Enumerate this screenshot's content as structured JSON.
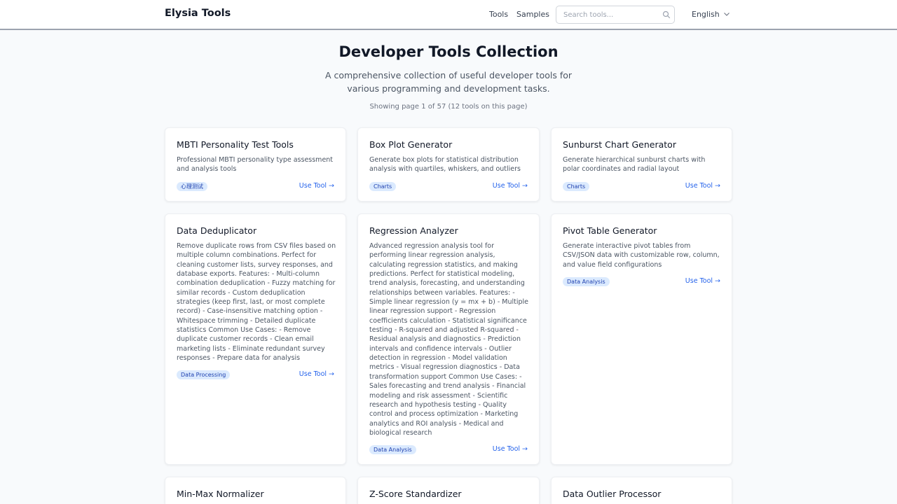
{
  "header": {
    "logo": "Elysia Tools",
    "nav": {
      "tools": "Tools",
      "samples": "Samples"
    },
    "search_placeholder": "Search tools...",
    "search_icon": "search-icon",
    "language": "English"
  },
  "hero": {
    "title": "Developer Tools Collection",
    "subtitle": "A comprehensive collection of useful developer tools for various programming and development tasks.",
    "page_info": "Showing page 1 of 57 (12 tools on this page)"
  },
  "cards": [
    {
      "title": "MBTI Personality Test Tools",
      "description": "Professional MBTI personality type assessment and analysis tools",
      "tag": "心理测试",
      "link": "Use Tool →"
    },
    {
      "title": "Box Plot Generator",
      "description": "Generate box plots for statistical distribution analysis with quartiles, whiskers, and outliers",
      "tag": "Charts",
      "link": "Use Tool →"
    },
    {
      "title": "Sunburst Chart Generator",
      "description": "Generate hierarchical sunburst charts with polar coordinates and radial layout",
      "tag": "Charts",
      "link": "Use Tool →"
    },
    {
      "title": "Data Deduplicator",
      "description": "Remove duplicate rows from CSV files based on multiple column combinations. Perfect for cleaning customer lists, survey responses, and database exports. Features: - Multi-column combination deduplication - Fuzzy matching for similar records - Custom deduplication strategies (keep first, last, or most complete record) - Case-insensitive matching option - Whitespace trimming - Detailed duplicate statistics Common Use Cases: - Remove duplicate customer records - Clean email marketing lists - Eliminate redundant survey responses - Prepare data for analysis",
      "tag": "Data Processing",
      "link": "Use Tool →"
    },
    {
      "title": "Regression Analyzer",
      "description": "Advanced regression analysis tool for performing linear regression analysis, calculating regression statistics, and making predictions. Perfect for statistical modeling, trend analysis, forecasting, and understanding relationships between variables. Features: - Simple linear regression (y = mx + b) - Multiple linear regression support - Regression coefficients calculation - Statistical significance testing - R-squared and adjusted R-squared - Residual analysis and diagnostics - Prediction intervals and confidence intervals - Outlier detection in regression - Model validation metrics - Visual regression diagnostics - Data transformation support Common Use Cases: - Sales forecasting and trend analysis - Financial modeling and risk assessment - Scientific research and hypothesis testing - Quality control and process optimization - Marketing analytics and ROI analysis - Medical and biological research",
      "tag": "Data Analysis",
      "link": "Use Tool →"
    },
    {
      "title": "Pivot Table Generator",
      "description": "Generate interactive pivot tables from CSV/JSON data with customizable row, column, and value field configurations",
      "tag": "Data Analysis",
      "link": "Use Tool →"
    },
    {
      "title": "Min-Max Normalizer"
    },
    {
      "title": "Z-Score Standardizer"
    },
    {
      "title": "Data Outlier Processor"
    }
  ]
}
